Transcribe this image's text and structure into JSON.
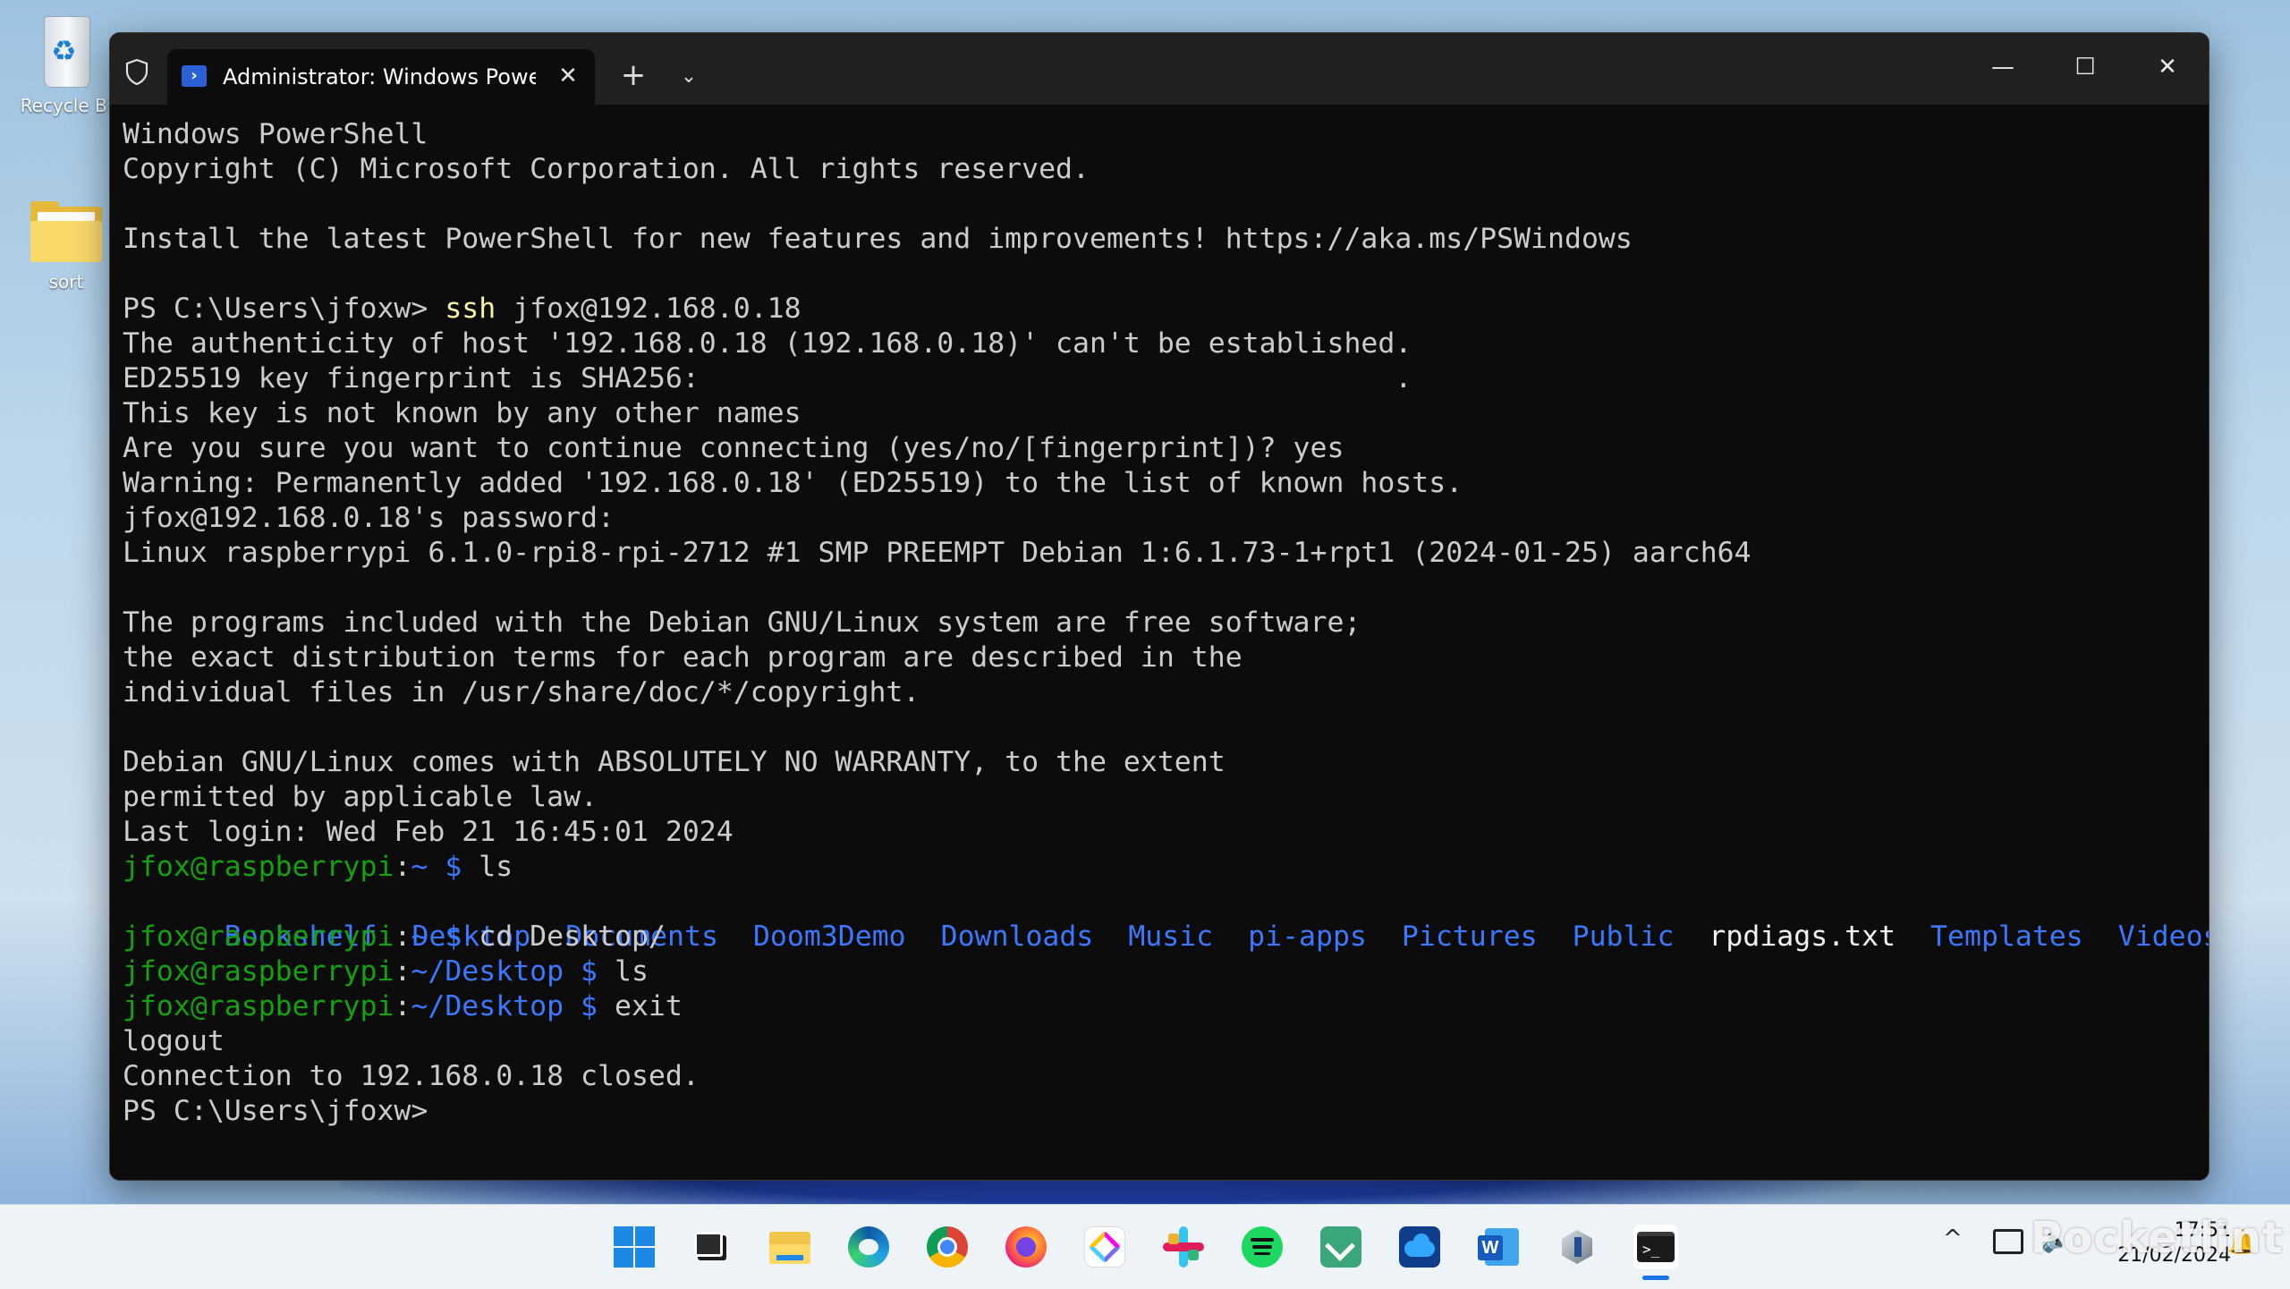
{
  "desktop": {
    "icons": [
      {
        "label": "Recycle Bi"
      },
      {
        "label": "sort"
      }
    ]
  },
  "window": {
    "tab_title": "Administrator: Windows Powe",
    "tab_close": "✕",
    "new_tab": "+",
    "dropdown": "⌄",
    "minimize": "—",
    "maximize": "☐",
    "close": "✕"
  },
  "console": {
    "l1": "Windows PowerShell",
    "l2": "Copyright (C) Microsoft Corporation. All rights reserved.",
    "l3": "Install the latest PowerShell for new features and improvements! https://aka.ms/PSWindows",
    "l4_prompt": "PS C:\\Users\\jfoxw> ",
    "l4_cmd": "ssh",
    "l4_args": " jfox@192.168.0.18",
    "l5": "The authenticity of host '192.168.0.18 (192.168.0.18)' can't be established.",
    "l6": "ED25519 key fingerprint is SHA256:                                         .",
    "l7": "This key is not known by any other names",
    "l8": "Are you sure you want to continue connecting (yes/no/[fingerprint])? yes",
    "l9": "Warning: Permanently added '192.168.0.18' (ED25519) to the list of known hosts.",
    "l10": "jfox@192.168.0.18's password:",
    "l11": "Linux raspberrypi 6.1.0-rpi8-rpi-2712 #1 SMP PREEMPT Debian 1:6.1.73-1+rpt1 (2024-01-25) aarch64",
    "l12": "The programs included with the Debian GNU/Linux system are free software;",
    "l13": "the exact distribution terms for each program are described in the",
    "l14": "individual files in /usr/share/doc/*/copyright.",
    "l15": "Debian GNU/Linux comes with ABSOLUTELY NO WARRANTY, to the extent",
    "l16": "permitted by applicable law.",
    "l17": "Last login: Wed Feb 21 16:45:01 2024",
    "user_host": "jfox@raspberrypi",
    "colon": ":",
    "home": "~",
    "desktop_path": "~/Desktop",
    "dollar": " $ ",
    "cmd_ls": "ls",
    "cmd_cd": "cd Desktop/",
    "cmd_exit": "exit",
    "ls_items": [
      "Bookshelf",
      "Desktop",
      "Documents",
      "Doom3Demo",
      "Downloads",
      "Music",
      "pi-apps",
      "Pictures",
      "Public",
      "rpdiags.txt",
      "Templates",
      "Videos"
    ],
    "logout": "logout",
    "closed": "Connection to 192.168.0.18 closed.",
    "final_prompt": "PS C:\\Users\\jfoxw>"
  },
  "taskbar": {
    "apps": [
      "start-icon",
      "task-view-icon",
      "file-explorer-icon",
      "edge-icon",
      "chrome-icon",
      "firefox-icon",
      "clickup-icon",
      "slack-icon",
      "spotify-icon",
      "feedly-icon",
      "onedrive-icon",
      "word-icon",
      "virtualbox-icon",
      "terminal-icon"
    ],
    "tray_chevron": "^",
    "time": "17:51",
    "date": "21/02/2024"
  },
  "watermark": "Pocketlint",
  "colors": {
    "prompt_green": "#13a10e",
    "dir_blue": "#3b78ff",
    "terminal_bg": "#0c0c0c"
  }
}
